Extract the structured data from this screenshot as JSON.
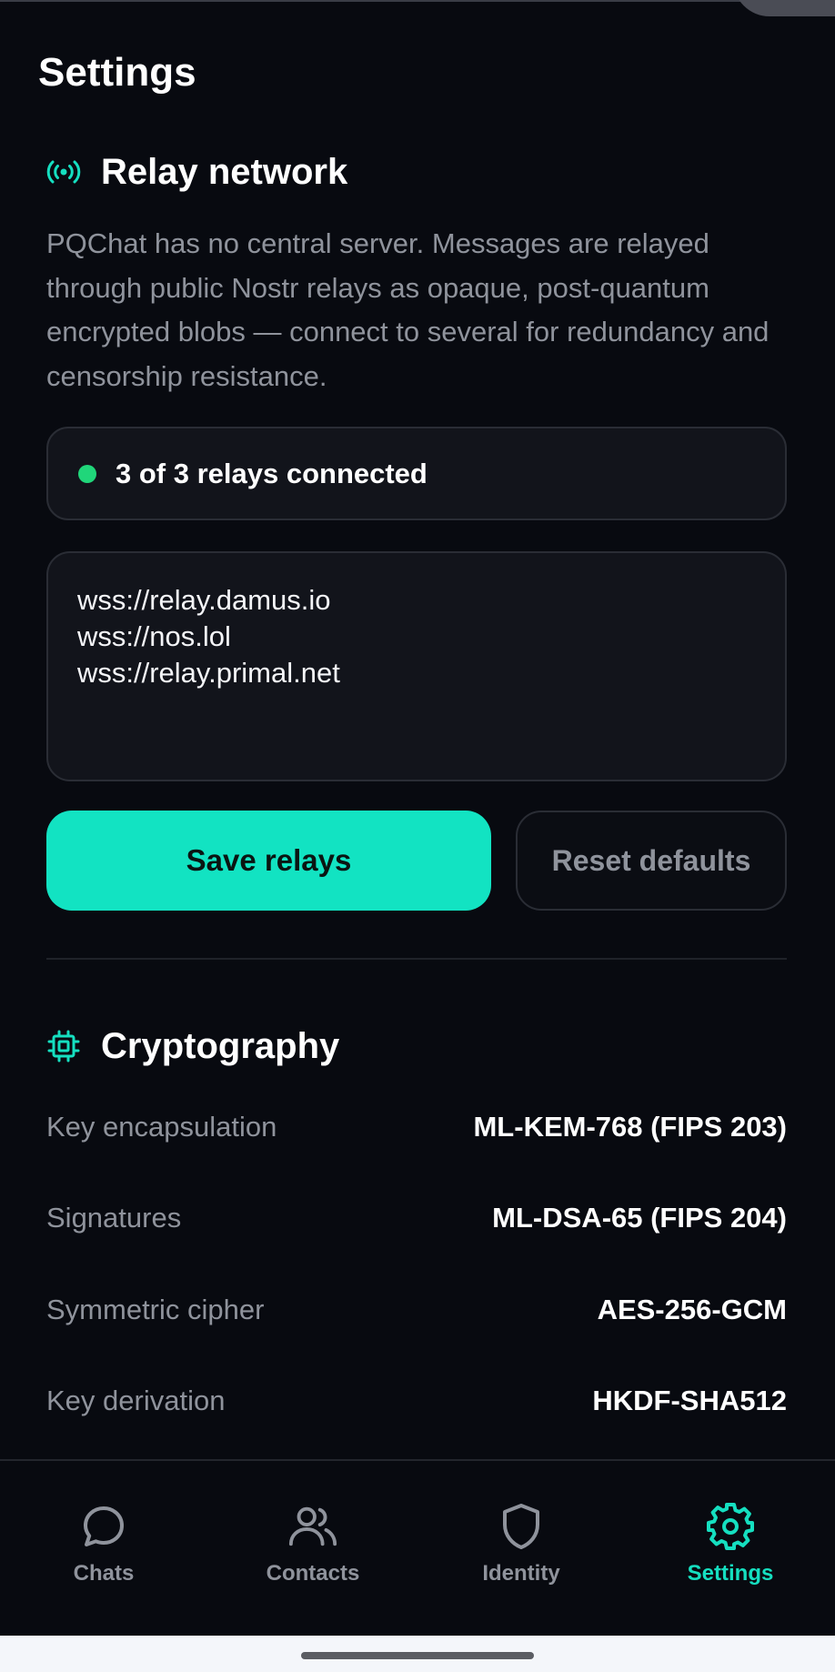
{
  "page_title": "Settings",
  "relay_section": {
    "title": "Relay network",
    "icon": "broadcast-icon",
    "description": "PQChat has no central server. Messages are relayed through public Nostr relays as opaque, post-quantum encrypted blobs — connect to several for redundancy and censorship resistance.",
    "status": "3 of 3 relays connected",
    "status_color": "#20d67a",
    "relays": [
      "wss://relay.damus.io",
      "wss://nos.lol",
      "wss://relay.primal.net"
    ],
    "save_label": "Save relays",
    "reset_label": "Reset defaults"
  },
  "crypto_section": {
    "title": "Cryptography",
    "icon": "chip-icon",
    "rows": [
      {
        "key": "Key encapsulation",
        "value": "ML-KEM-768 (FIPS 203)"
      },
      {
        "key": "Signatures",
        "value": "ML-DSA-65 (FIPS 204)"
      },
      {
        "key": "Symmetric cipher",
        "value": "AES-256-GCM"
      },
      {
        "key": "Key derivation",
        "value": "HKDF-SHA512"
      }
    ]
  },
  "nav": {
    "items": [
      {
        "label": "Chats",
        "icon": "chat-bubble-icon"
      },
      {
        "label": "Contacts",
        "icon": "people-icon"
      },
      {
        "label": "Identity",
        "icon": "shield-icon"
      },
      {
        "label": "Settings",
        "icon": "gear-icon",
        "active": true
      }
    ]
  },
  "colors": {
    "accent": "#12e3c2",
    "background": "#080a10",
    "muted_text": "#8f939c"
  }
}
